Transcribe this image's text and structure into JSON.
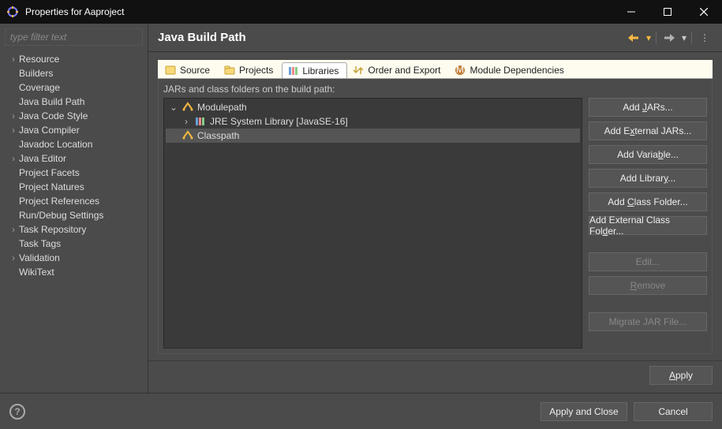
{
  "title": "Properties for Aaproject",
  "sidebar": {
    "filter_placeholder": "type filter text",
    "items": [
      {
        "label": "Resource",
        "expandable": true
      },
      {
        "label": "Builders"
      },
      {
        "label": "Coverage"
      },
      {
        "label": "Java Build Path"
      },
      {
        "label": "Java Code Style",
        "expandable": true
      },
      {
        "label": "Java Compiler",
        "expandable": true
      },
      {
        "label": "Javadoc Location"
      },
      {
        "label": "Java Editor",
        "expandable": true
      },
      {
        "label": "Project Facets"
      },
      {
        "label": "Project Natures"
      },
      {
        "label": "Project References"
      },
      {
        "label": "Run/Debug Settings"
      },
      {
        "label": "Task Repository",
        "expandable": true
      },
      {
        "label": "Task Tags"
      },
      {
        "label": "Validation",
        "expandable": true
      },
      {
        "label": "WikiText"
      }
    ]
  },
  "header": {
    "title": "Java Build Path"
  },
  "tabs": [
    {
      "label": "Source",
      "icon": "source"
    },
    {
      "label": "Projects",
      "icon": "projects"
    },
    {
      "label": "Libraries",
      "icon": "libraries",
      "active": true
    },
    {
      "label": "Order and Export",
      "icon": "order"
    },
    {
      "label": "Module Dependencies",
      "icon": "module"
    }
  ],
  "libraries": {
    "desc": "JARs and class folders on the build path:",
    "tree": {
      "modulepath": {
        "label": "Modulepath"
      },
      "jre": {
        "label": "JRE System Library [JavaSE-16]"
      },
      "classpath": {
        "label": "Classpath"
      }
    },
    "buttons": {
      "add_jars": "Add JARs...",
      "add_ext_jars": "Add External JARs...",
      "add_variable": "Add Variable...",
      "add_library": "Add Library...",
      "add_class_folder": "Add Class Folder...",
      "add_ext_class_folder": "Add External Class Folder...",
      "edit": "Edit...",
      "remove": "Remove",
      "migrate": "Migrate JAR File..."
    }
  },
  "footer": {
    "apply": "Apply",
    "apply_close": "Apply and Close",
    "cancel": "Cancel"
  }
}
